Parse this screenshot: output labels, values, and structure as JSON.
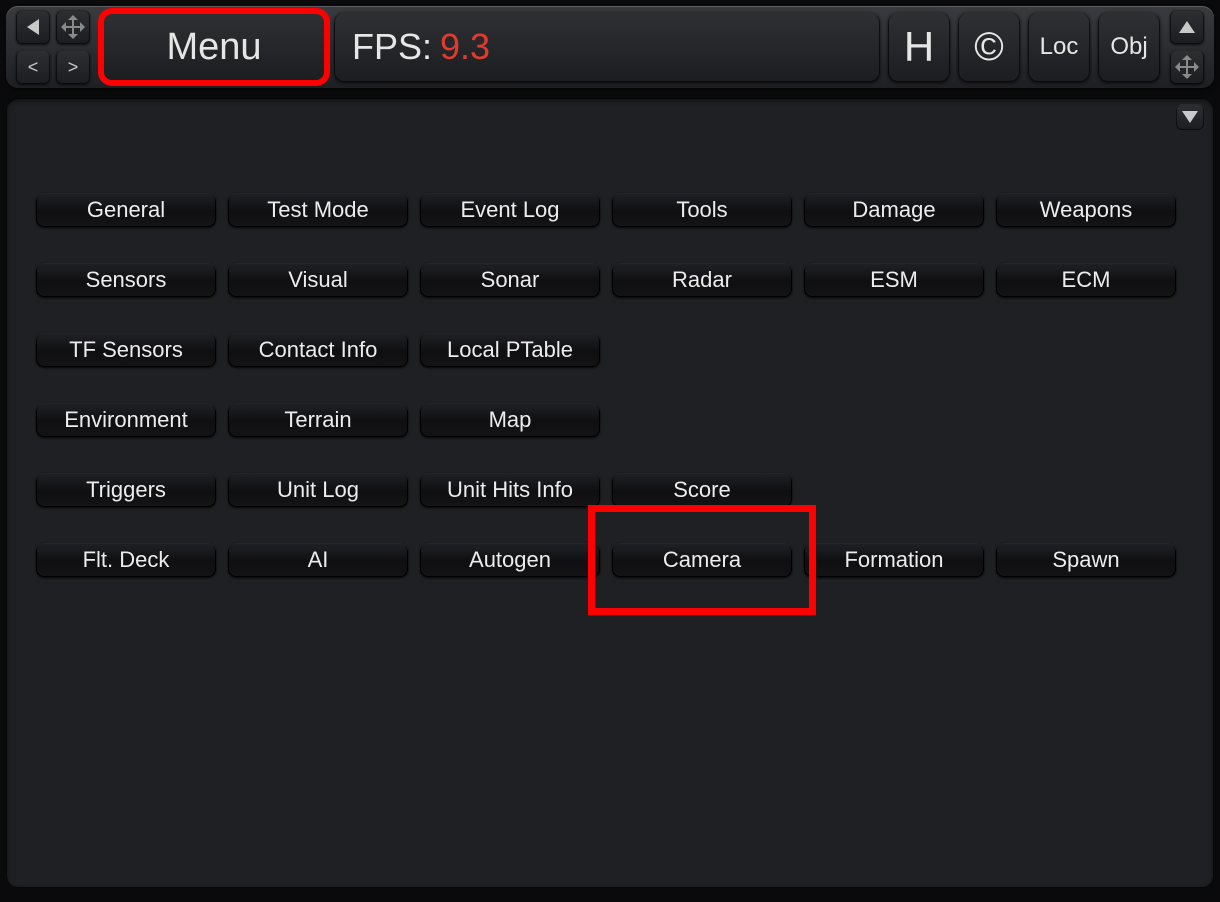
{
  "topbar": {
    "menu_label": "Menu",
    "fps_label": "FPS:",
    "fps_value": "9.3",
    "helper_h": "H",
    "helper_c": "©",
    "loc_label": "Loc",
    "obj_label": "Obj",
    "nav_prev": "<",
    "nav_next": ">"
  },
  "menu": {
    "rows": [
      [
        "General",
        "Test Mode",
        "Event Log",
        "Tools",
        "Damage",
        "Weapons"
      ],
      [
        "Sensors",
        "Visual",
        "Sonar",
        "Radar",
        "ESM",
        "ECM"
      ],
      [
        "TF Sensors",
        "Contact Info",
        "Local PTable",
        "",
        "",
        ""
      ],
      [
        "Environment",
        "Terrain",
        "Map",
        "",
        "",
        ""
      ],
      [
        "Triggers",
        "Unit Log",
        "Unit Hits Info",
        "Score",
        "",
        ""
      ],
      [
        "Flt. Deck",
        "AI",
        "Autogen",
        "Camera",
        "Formation",
        "Spawn"
      ]
    ]
  },
  "highlights": {
    "menu_button": true,
    "camera_button": true
  }
}
